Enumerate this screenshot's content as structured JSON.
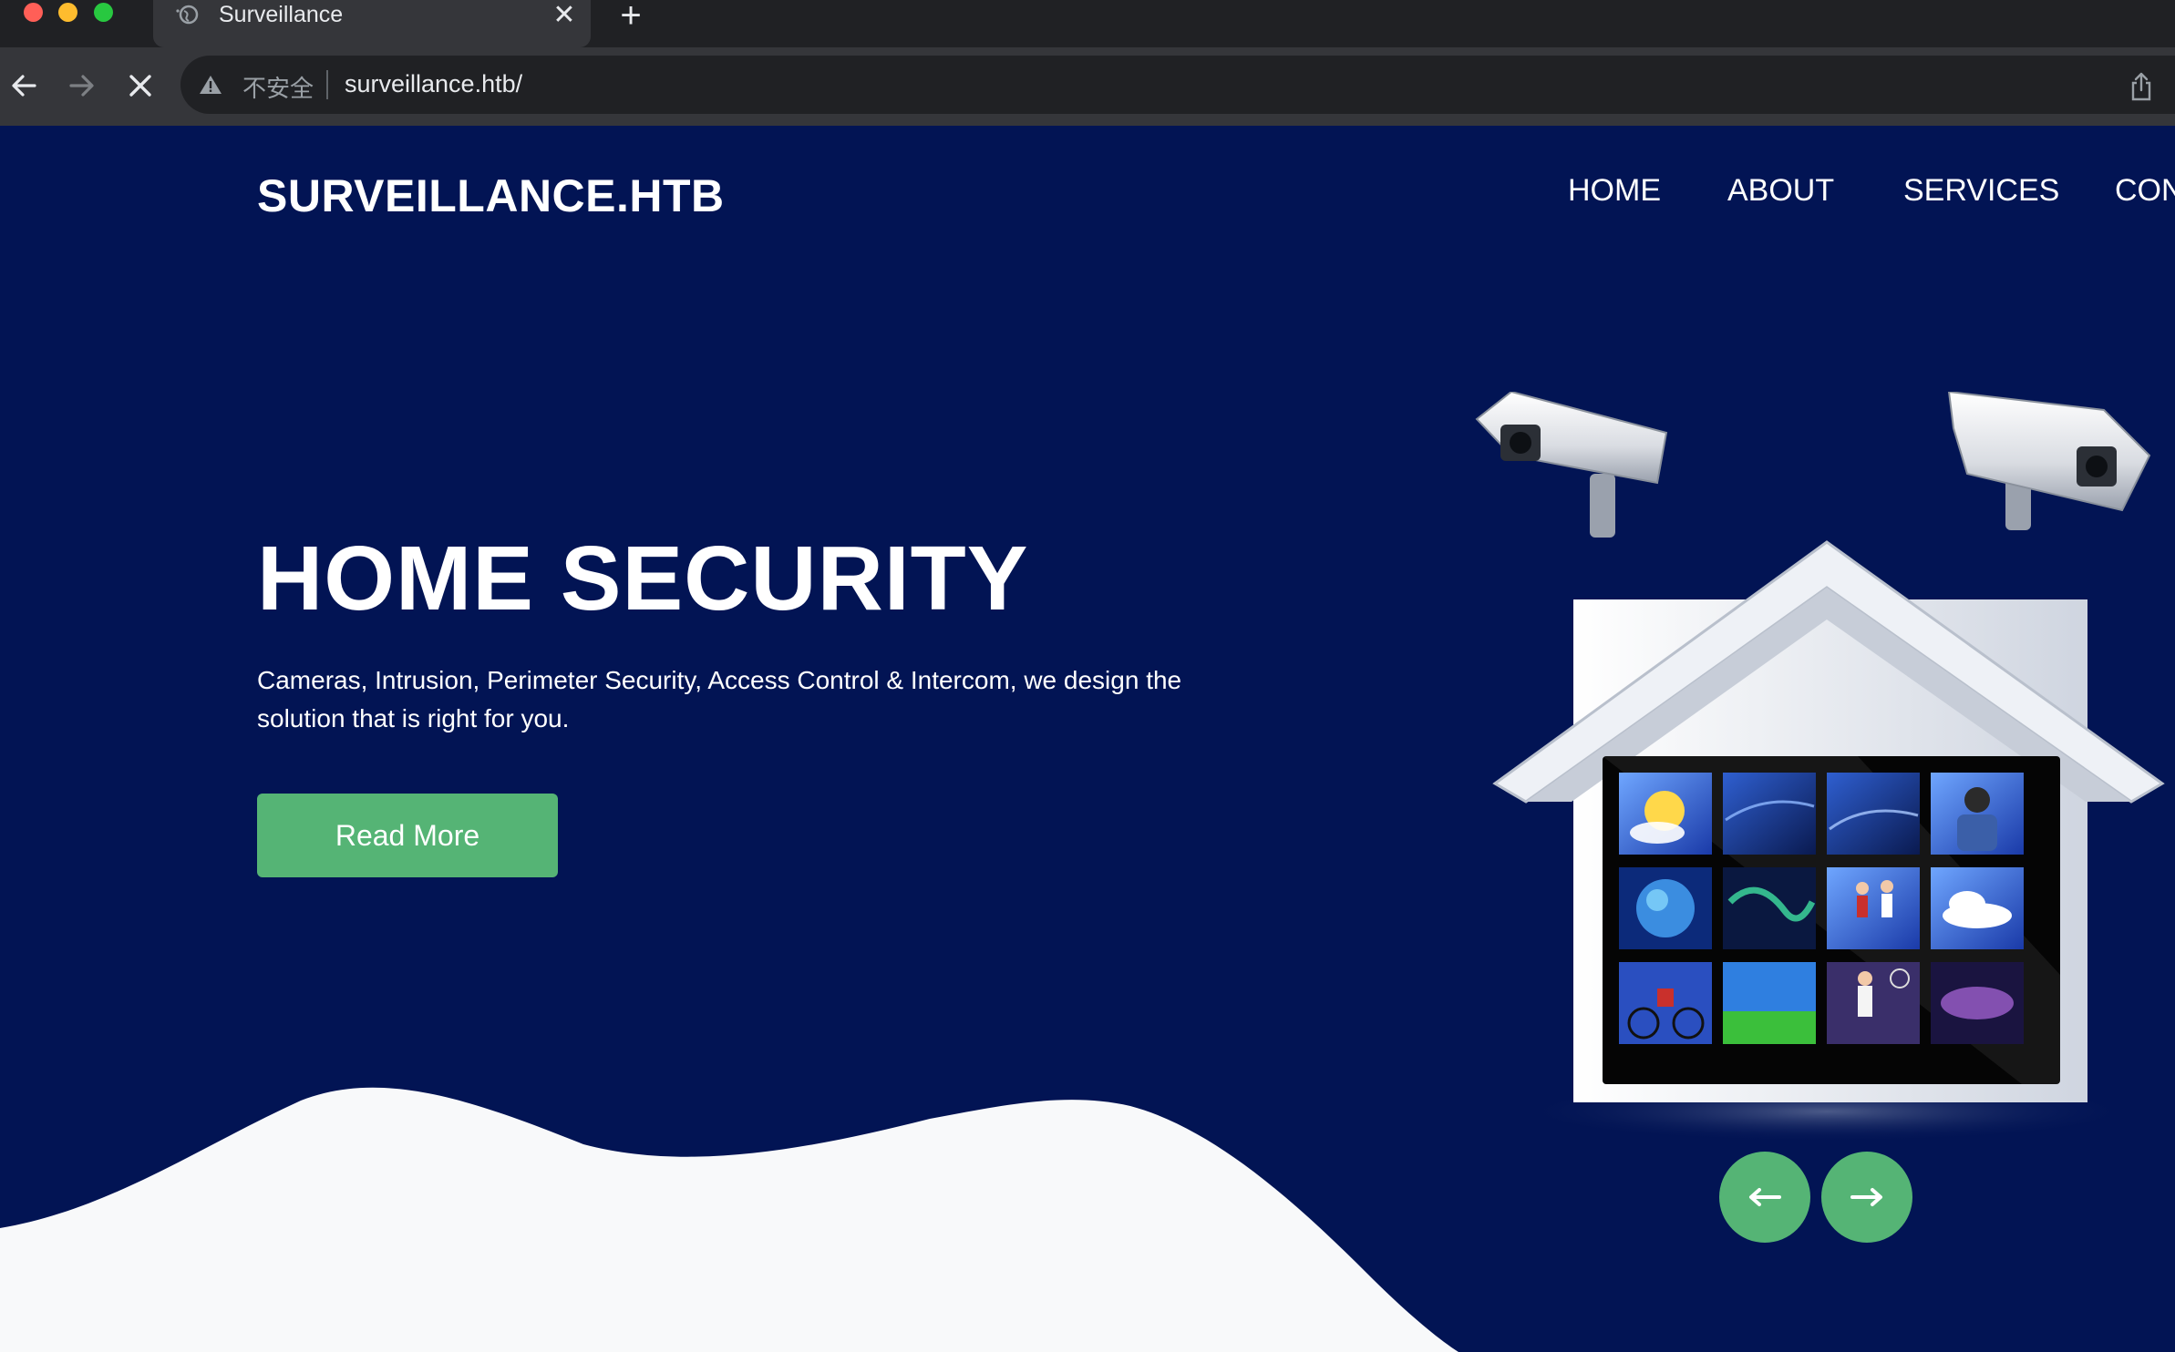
{
  "browser": {
    "tab_title": "Surveillance",
    "new_tab_symbol": "+",
    "close_symbol": "✕",
    "security_label": "不安全",
    "url": "surveillance.htb/",
    "icons": [
      "arrow-left-icon",
      "arrow-right-icon",
      "stop-icon",
      "warning-icon",
      "share-icon",
      "globe-icon"
    ]
  },
  "site": {
    "brand": "SURVEILLANCE.HTB",
    "nav": [
      "HOME",
      "ABOUT",
      "SERVICES",
      "CON"
    ]
  },
  "hero": {
    "title": "HOME SECURITY",
    "text": "Cameras, Intrusion, Perimeter Security, Access Control & Intercom, we design the solution that is right for you.",
    "button": "Read More"
  },
  "carousel": {
    "prev_icon": "arrow-left-icon",
    "next_icon": "arrow-right-icon"
  },
  "colors": {
    "background": "#021454",
    "accent": "#55b475",
    "wave": "#f8f9fa"
  }
}
